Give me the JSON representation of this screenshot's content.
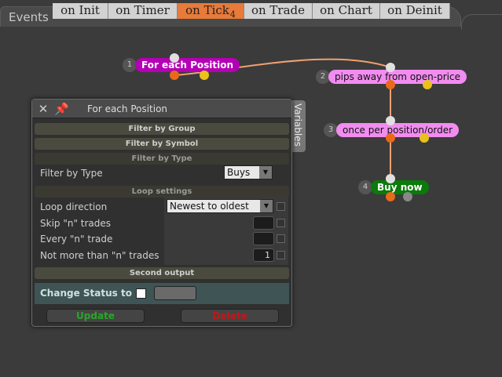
{
  "events": {
    "label": "Events",
    "tabs": [
      {
        "label": "on Init"
      },
      {
        "label": "on Timer"
      },
      {
        "label": "on Tick",
        "badge": "4",
        "active": true
      },
      {
        "label": "on Trade"
      },
      {
        "label": "on Chart"
      },
      {
        "label": "on Deinit"
      }
    ]
  },
  "nodes": [
    {
      "num": "1",
      "label": "For each Position",
      "color": "#b400b4",
      "text_color": "#ffffff"
    },
    {
      "num": "2",
      "label": "pips away from open-price",
      "color": "#f28cf0",
      "text_color": "#111111"
    },
    {
      "num": "3",
      "label": "once per position/order",
      "color": "#f28cf0",
      "text_color": "#111111"
    },
    {
      "num": "4",
      "label": "Buy now",
      "color": "#0a7a0a",
      "text_color": "#ffffff"
    }
  ],
  "panel": {
    "title": "For each Position",
    "side_tab": "Variables",
    "sections": {
      "filter_group": "Filter by Group",
      "filter_symbol": "Filter by Symbol",
      "filter_type": "Filter by Type",
      "loop": "Loop settings",
      "second_output": "Second output"
    },
    "filter_type": {
      "label": "Filter by Type",
      "value": "Buys"
    },
    "loop": {
      "direction_label": "Loop direction",
      "direction_value": "Newest to oldest",
      "skip_label": "Skip \"n\" trades",
      "skip_value": "",
      "every_label": "Every \"n\" trade",
      "every_value": "",
      "limit_label": "Not more than \"n\" trades",
      "limit_value": "1"
    },
    "status": {
      "label": "Change Status to"
    },
    "buttons": {
      "update": "Update",
      "delete": "Delete"
    },
    "colors": {
      "update": "#27a827",
      "delete": "#c01818",
      "accent": "#e87a3a"
    }
  }
}
